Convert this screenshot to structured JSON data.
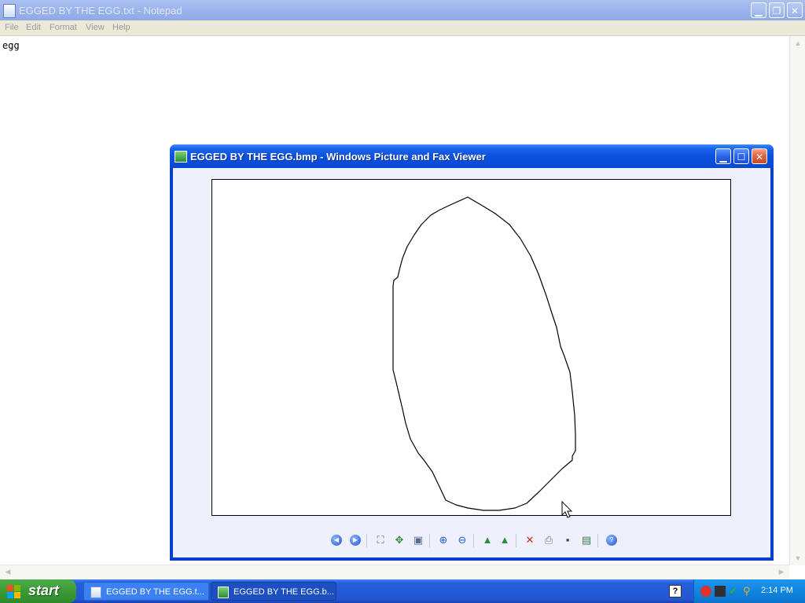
{
  "notepad": {
    "title": "EGGED BY THE EGG.txt - Notepad",
    "menu": [
      "File",
      "Edit",
      "Format",
      "View",
      "Help"
    ],
    "content": "egg"
  },
  "viewer": {
    "title": "EGGED BY THE EGG.bmp - Windows Picture and Fax Viewer",
    "toolbar": [
      "previous-image",
      "next-image",
      "best-fit",
      "actual-size",
      "start-slide-show",
      "zoom-in",
      "zoom-out",
      "rotate-clockwise",
      "rotate-counterclockwise",
      "delete",
      "print",
      "copy-to",
      "open-for-editing",
      "help"
    ]
  },
  "taskbar": {
    "start_label": "start",
    "tasks": [
      {
        "label": "EGGED BY THE EGG.t...",
        "active": false
      },
      {
        "label": "EGGED BY THE EGG.b...",
        "active": true
      }
    ],
    "clock": "2:14 PM"
  },
  "colors": {
    "title_active": "#0a50df",
    "title_inactive": "#9bb4ea",
    "taskbar": "#245edb",
    "start": "#3c9b37",
    "tray": "#0f85e0",
    "viewer_client": "#eef1fb"
  }
}
